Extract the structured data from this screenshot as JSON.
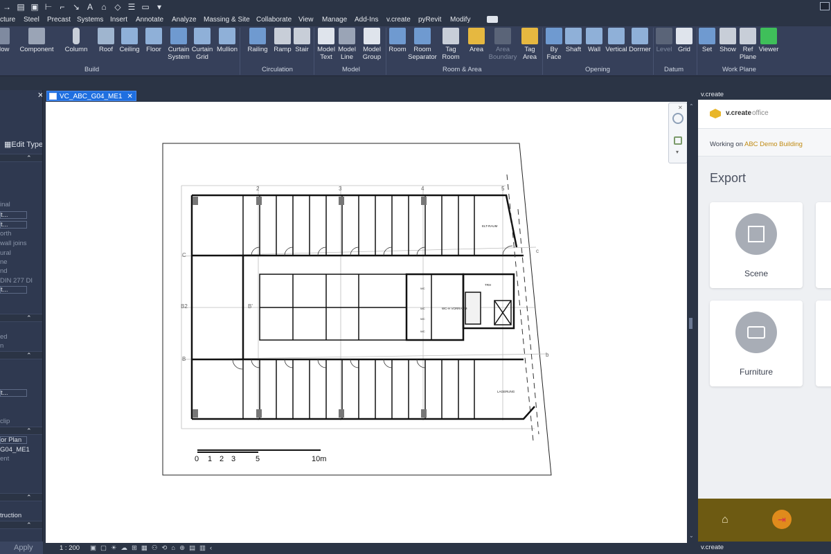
{
  "qat": {
    "icons": [
      "arrow-icon",
      "save-icon",
      "measure-icon",
      "dimension-icon",
      "text-a-icon",
      "home-icon",
      "tag-icon",
      "thin-lines-icon",
      "switch-windows-icon",
      "dropdown-icon"
    ]
  },
  "tabs": [
    "cture",
    "Steel",
    "Precast",
    "Systems",
    "Insert",
    "Annotate",
    "Analyze",
    "Massing & Site",
    "Collaborate",
    "View",
    "Manage",
    "Add-Ins",
    "v.create",
    "pyRevit",
    "Modify"
  ],
  "ribbon": {
    "buttons": [
      {
        "label": "ndow",
        "sub": ""
      },
      {
        "label": "Component",
        "sub": ""
      },
      {
        "label": "Column",
        "sub": ""
      },
      {
        "label": "Roof",
        "sub": ""
      },
      {
        "label": "Ceiling",
        "sub": ""
      },
      {
        "label": "Floor",
        "sub": ""
      },
      {
        "label": "Curtain",
        "sub": "System"
      },
      {
        "label": "Curtain",
        "sub": "Grid"
      },
      {
        "label": "Mullion",
        "sub": ""
      },
      {
        "label": "Railing",
        "sub": ""
      },
      {
        "label": "Ramp",
        "sub": ""
      },
      {
        "label": "Stair",
        "sub": ""
      },
      {
        "label": "Model",
        "sub": "Text"
      },
      {
        "label": "Model",
        "sub": "Line"
      },
      {
        "label": "Model",
        "sub": "Group"
      },
      {
        "label": "Room",
        "sub": ""
      },
      {
        "label": "Room",
        "sub": "Separator"
      },
      {
        "label": "Tag",
        "sub": "Room"
      },
      {
        "label": "Area",
        "sub": ""
      },
      {
        "label": "Area",
        "sub": "Boundary"
      },
      {
        "label": "Tag",
        "sub": "Area"
      },
      {
        "label": "By",
        "sub": "Face"
      },
      {
        "label": "Shaft",
        "sub": ""
      },
      {
        "label": "Wall",
        "sub": ""
      },
      {
        "label": "Vertical",
        "sub": ""
      },
      {
        "label": "Dormer",
        "sub": ""
      },
      {
        "label": "Level",
        "sub": ""
      },
      {
        "label": "Grid",
        "sub": ""
      },
      {
        "label": "Set",
        "sub": ""
      },
      {
        "label": "Show",
        "sub": ""
      },
      {
        "label": "Ref",
        "sub": "Plane"
      },
      {
        "label": "Viewer",
        "sub": ""
      }
    ],
    "panels": [
      "Build",
      "Circulation",
      "Model",
      "Room & Area",
      "Opening",
      "Datum",
      "Work Plane"
    ]
  },
  "properties": {
    "edit_type": "Edit Type",
    "rows": [
      "inal",
      "t...",
      "t...",
      "orth",
      "wall joins",
      "ural",
      "ne",
      "nd",
      "DIN 277 DI",
      "t...",
      "ed",
      "n",
      "t...",
      "clip",
      "or Plan",
      "G04_ME1",
      "ent",
      "truction"
    ],
    "apply": "Apply"
  },
  "view": {
    "tab_label": "VC_ABC_G04_ME1",
    "scale": "1 : 200",
    "grid_top": [
      "2",
      "3",
      "4",
      "5"
    ],
    "grid_left": [
      "C",
      "B2",
      "B"
    ],
    "grid_right": [
      "c",
      "b"
    ],
    "grid_b_prime": "B'",
    "room_labels": {
      "elt": "ELT-RAUM",
      "trh": "TRH",
      "wc_vorraum": "WC-H VORRAUM",
      "wc1": "WC",
      "wc2": "WC",
      "wc3": "WC",
      "wc4": "WC",
      "lagerung": "LAGERUNG"
    },
    "scalebar": {
      "ticks": [
        "0",
        "1",
        "2",
        "3",
        "5",
        "10m"
      ]
    }
  },
  "side_panel": {
    "header": "v.create",
    "logo_text": "v.create",
    "logo_sub": " office",
    "working_prefix": "Working on ",
    "working_project": "ABC Demo Building",
    "section_title": "Export",
    "cards": [
      {
        "label": "Scene"
      },
      {
        "label": "Furniture"
      }
    ],
    "footer": "v.create"
  },
  "colors": {
    "accent": "#1f6fe0",
    "vcreate_gold": "#c08a12",
    "footer": "#6d5a12",
    "exit_button": "#e08b1c"
  }
}
